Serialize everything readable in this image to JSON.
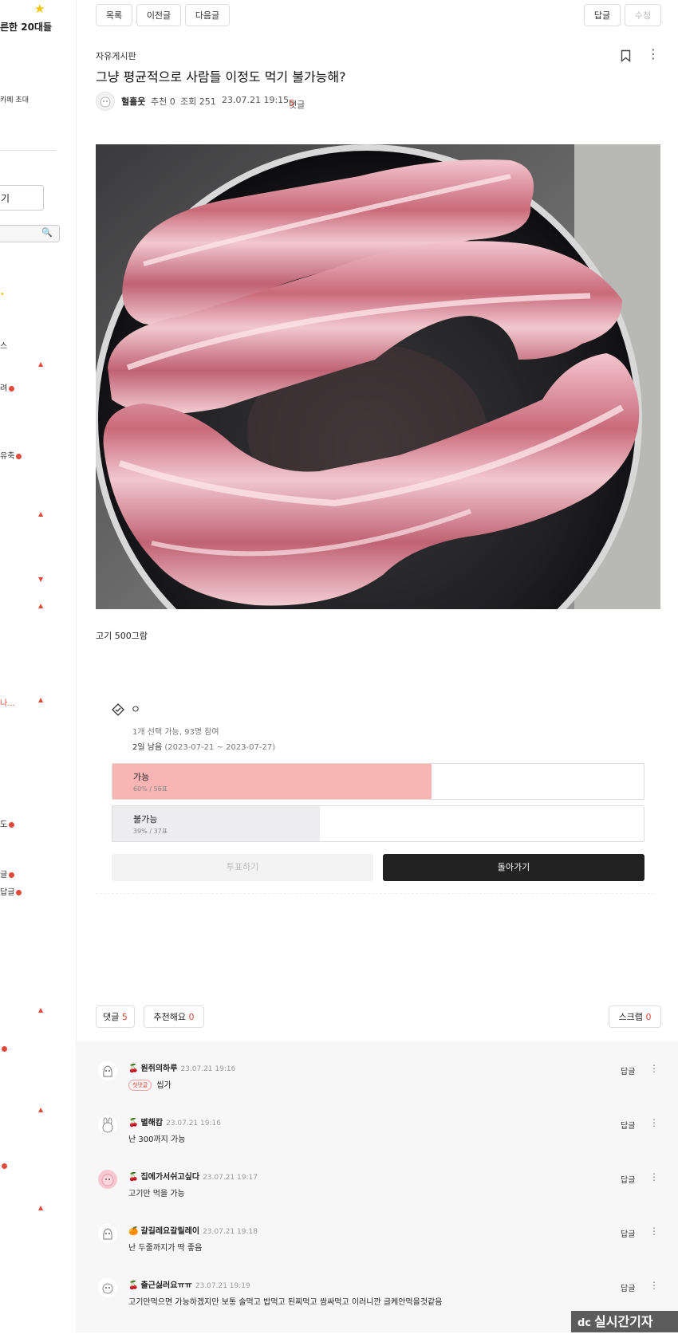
{
  "sidebar": {
    "cafe_title_fragment": "른한 20대들",
    "invite_fragment": "카페 초대",
    "write_fragment": "기",
    "fragments": [
      "스",
      "려",
      "유축",
      "나...",
      "도",
      "글",
      "답글"
    ]
  },
  "toolbar": {
    "list_label": "목록",
    "prev_label": "이전글",
    "next_label": "다음글",
    "reply_label": "답글",
    "edit_label": "수정"
  },
  "post": {
    "board": "자유게시판",
    "title": "그냥 평균적으로 사람들 이정도 먹기 불가능해?",
    "author": "헐홀웃",
    "recommend": "추천 0",
    "views": "조회 251",
    "datetime": "23.07.21 19:15",
    "comments_label": "댓글",
    "comments_count": "5",
    "caption": "고기 500그람"
  },
  "poll": {
    "title": "ㅇ",
    "info": "1개 선택 가능, 93명 참여",
    "remain": "2일 남음",
    "period": "(2023-07-21 ~ 2023-07-27)",
    "options": [
      {
        "label": "가능",
        "stats": "60% / 56표",
        "percent": 60,
        "color": "#f9b4b4"
      },
      {
        "label": "불가능",
        "stats": "39% / 37표",
        "percent": 39,
        "color": "#ededf0"
      }
    ],
    "vote_label": "투표하기",
    "back_label": "돌아가기"
  },
  "actions": {
    "comment_label": "댓글",
    "comment_count": "5",
    "recommend_label": "추천해요",
    "recommend_count": "0",
    "scrap_label": "스크랩",
    "scrap_count": "0"
  },
  "comments": [
    {
      "icon": "🍒",
      "name": "원쥐의하루",
      "date": "23.07.21 19:16",
      "tag": "첫댓글",
      "text": "씹가",
      "reply": "답글",
      "avatar_bg": "#ffffff"
    },
    {
      "icon": "🍒",
      "name": "별해캄",
      "date": "23.07.21 19:16",
      "tag": "",
      "text": "난 300까지 가능",
      "reply": "답글",
      "avatar_bg": "#ffffff"
    },
    {
      "icon": "🍒",
      "name": "집에가서쉬고싶다",
      "date": "23.07.21 19:17",
      "tag": "",
      "text": "고기만 먹을 가능",
      "reply": "답글",
      "avatar_bg": "#f8c8d0"
    },
    {
      "icon": "🍊",
      "name": "갈길레요갈릴레이",
      "date": "23.07.21 19:18",
      "tag": "",
      "text": "난 두줄까지가 딱 좋음",
      "reply": "답글",
      "avatar_bg": "#ffffff"
    },
    {
      "icon": "🍒",
      "name": "출근싫러요ㅠㅠ",
      "date": "23.07.21 19:19",
      "tag": "",
      "text": "고기만먹으면 가능하겠지만 보통 술먹고 밥먹고 된찌먹고 쌈싸먹고 이러니깐 글케안먹을것같음",
      "reply": "답글",
      "avatar_bg": "#ffffff"
    }
  ],
  "watermark": {
    "logo": "dc",
    "text": "실시간기자"
  }
}
